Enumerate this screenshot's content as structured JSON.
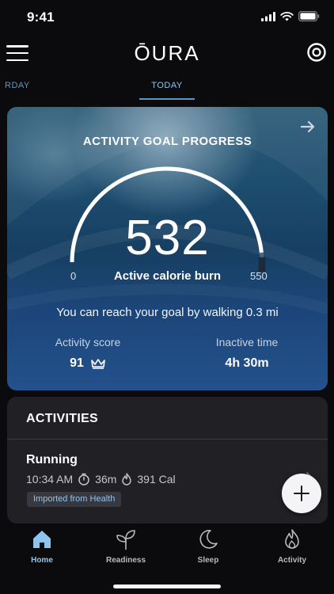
{
  "status_bar": {
    "time": "9:41"
  },
  "header": {
    "brand": "ŌURA",
    "menu_icon": "hamburger-menu-icon",
    "ring_icon": "ring-icon"
  },
  "date_tabs": {
    "previous": "RDAY",
    "current": "TODAY"
  },
  "goal_card": {
    "title": "ACTIVITY GOAL PROGRESS",
    "value": "532",
    "value_label": "Active calorie burn",
    "min": "0",
    "max": "550",
    "progress": 0.967,
    "message": "You can reach your goal by walking 0.3 mi",
    "activity_score_label": "Activity score",
    "activity_score": "91",
    "inactive_time_label": "Inactive time",
    "inactive_time": "4h 30m"
  },
  "activities": {
    "title": "ACTIVITIES",
    "items": [
      {
        "name": "Running",
        "time": "10:34 AM",
        "duration": "36m",
        "calories": "391 Cal",
        "source": "Imported from Health"
      }
    ]
  },
  "tab_bar": {
    "items": [
      {
        "label": "Home",
        "icon": "home-icon",
        "active": true
      },
      {
        "label": "Readiness",
        "icon": "sprout-icon",
        "active": false
      },
      {
        "label": "Sleep",
        "icon": "moon-icon",
        "active": false
      },
      {
        "label": "Activity",
        "icon": "flame-icon",
        "active": false
      }
    ]
  },
  "colors": {
    "accent": "#8fc4ee",
    "background": "#0b0b0d",
    "card": "#212125"
  }
}
